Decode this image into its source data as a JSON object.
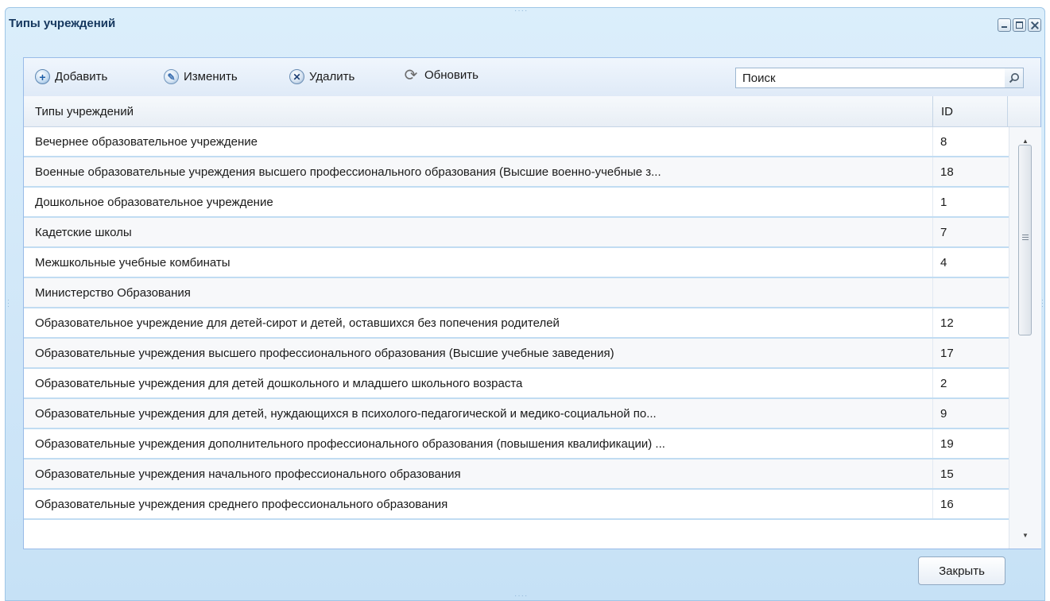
{
  "window": {
    "title": "Типы учреждений",
    "controls": {
      "minimize": "minimize",
      "maximize": "maximize",
      "close": "close"
    }
  },
  "toolbar": {
    "add_label": "Добавить",
    "edit_label": "Изменить",
    "delete_label": "Удалить",
    "refresh_label": "Обновить",
    "search_value": "Поиск",
    "icons": {
      "add": "plus-icon",
      "edit": "pencil-icon",
      "delete": "cross-icon",
      "refresh": "refresh-icon",
      "search": "search-icon"
    }
  },
  "grid": {
    "columns": {
      "name": "Типы учреждений",
      "id": "ID"
    },
    "rows": [
      {
        "name": "Вечернее образовательное учреждение",
        "id": "8"
      },
      {
        "name": "Военные образовательные учреждения высшего профессионального образования (Высшие военно-учебные з...",
        "id": "18"
      },
      {
        "name": "Дошкольное образовательное учреждение",
        "id": "1"
      },
      {
        "name": "Кадетские школы",
        "id": "7"
      },
      {
        "name": "Межшкольные учебные комбинаты",
        "id": "4"
      },
      {
        "name": "Министерство Образования",
        "id": ""
      },
      {
        "name": "Образовательное учреждение для детей-сирот и детей, оставшихся без попечения родителей",
        "id": "12"
      },
      {
        "name": "Образовательные учреждения высшего профессионального образования (Высшие учебные заведения)",
        "id": "17"
      },
      {
        "name": "Образовательные учреждения для детей дошкольного и младшего школьного возраста",
        "id": "2"
      },
      {
        "name": "Образовательные учреждения для детей, нуждающихся в психолого-педагогической и медико-социальной по...",
        "id": "9"
      },
      {
        "name": "Образовательные учреждения дополнительного профессионального образования (повышения квалификации) ...",
        "id": "19"
      },
      {
        "name": "Образовательные учреждения начального профессионального образования",
        "id": "15"
      },
      {
        "name": "Образовательные учреждения среднего профессионального образования",
        "id": "16"
      }
    ]
  },
  "footer": {
    "close_label": "Закрыть"
  },
  "colors": {
    "accent": "#99bbe8",
    "window_bg": "#cfe6f8",
    "title": "#16385f",
    "row_border": "#c1dcf2"
  }
}
